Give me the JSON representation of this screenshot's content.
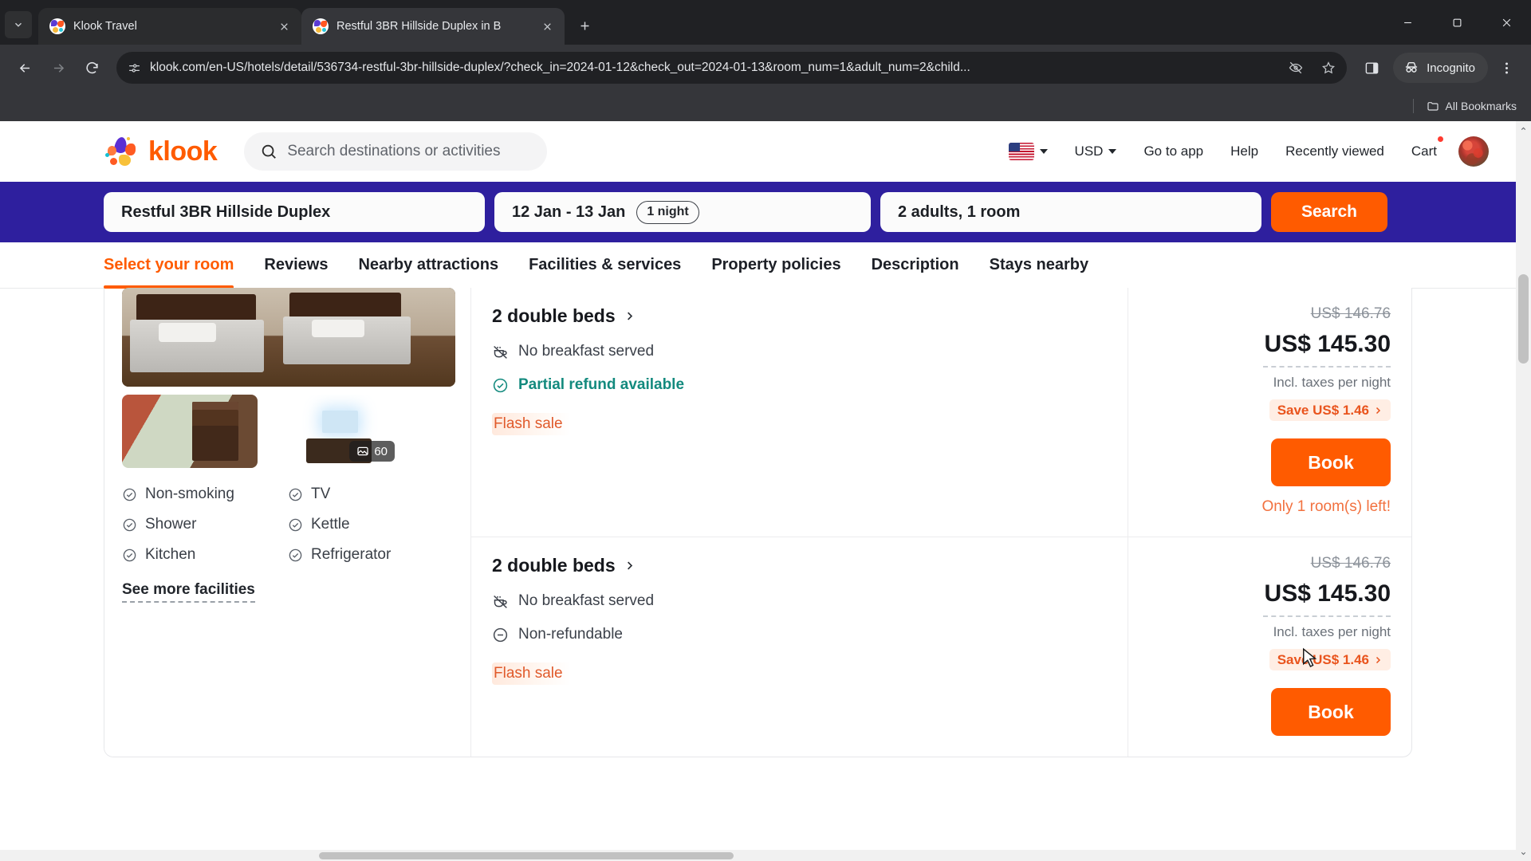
{
  "browser": {
    "tabs": [
      {
        "title": "Klook Travel",
        "active": false
      },
      {
        "title": "Restful 3BR Hillside Duplex in B",
        "active": true
      }
    ],
    "new_tab_label": "+",
    "url": "klook.com/en-US/hotels/detail/536734-restful-3br-hillside-duplex/?check_in=2024-01-12&check_out=2024-01-13&room_num=1&adult_num=2&child...",
    "profile_label": "Incognito",
    "bookmarks_label": "All Bookmarks",
    "window_controls": {
      "minimize": "minimize-icon",
      "maximize": "maximize-icon",
      "close": "close-icon"
    }
  },
  "site_header": {
    "brand": "klook",
    "search_placeholder": "Search destinations or activities",
    "locale_flag": "us-flag-icon",
    "currency": "USD",
    "links": [
      "Go to app",
      "Help",
      "Recently viewed",
      "Cart"
    ]
  },
  "search_band": {
    "destination": "Restful 3BR Hillside Duplex",
    "dates": "12 Jan - 13 Jan",
    "nights": "1 night",
    "occupancy": "2 adults, 1 room",
    "search_label": "Search"
  },
  "nav_tabs": [
    {
      "label": "Select your room",
      "active": true
    },
    {
      "label": "Reviews",
      "active": false
    },
    {
      "label": "Nearby attractions",
      "active": false
    },
    {
      "label": "Facilities & services",
      "active": false
    },
    {
      "label": "Property policies",
      "active": false
    },
    {
      "label": "Description",
      "active": false
    },
    {
      "label": "Stays nearby",
      "active": false
    }
  ],
  "room_card": {
    "photo_count": "60",
    "facilities": [
      "Non-smoking",
      "TV",
      "Shower",
      "Kettle",
      "Kitchen",
      "Refrigerator"
    ],
    "see_more_label": "See more facilities",
    "rows": [
      {
        "bed_config": "2 double beds",
        "breakfast": "No breakfast served",
        "refund": "Partial refund available",
        "refund_type": "partial",
        "promo": "Flash sale",
        "old_price": "US$ 146.76",
        "price": "US$ 145.30",
        "price_note": "Incl. taxes per night",
        "save_label": "Save US$ 1.46",
        "book_label": "Book",
        "availability": "Only 1 room(s) left!"
      },
      {
        "bed_config": "2 double beds",
        "breakfast": "No breakfast served",
        "refund": "Non-refundable",
        "refund_type": "none",
        "promo": "Flash sale",
        "old_price": "US$ 146.76",
        "price": "US$ 145.30",
        "price_note": "Incl. taxes per night",
        "save_label": "Save US$ 1.46",
        "book_label": "Book",
        "availability": ""
      }
    ]
  },
  "colors": {
    "brand_orange": "#ff5b00",
    "band_indigo": "#2e1f9e",
    "teal": "#138a7e",
    "muted": "#6b7179"
  }
}
